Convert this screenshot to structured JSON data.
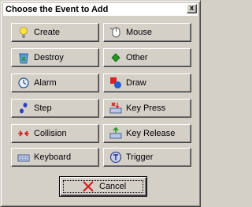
{
  "window": {
    "title": "Choose the Event to Add",
    "close_glyph": "x"
  },
  "events": [
    {
      "label": "Create",
      "icon": "lightbulb-icon"
    },
    {
      "label": "Mouse",
      "icon": "mouse-icon"
    },
    {
      "label": "Destroy",
      "icon": "trash-icon"
    },
    {
      "label": "Other",
      "icon": "green-diamond-icon"
    },
    {
      "label": "Alarm",
      "icon": "clock-icon"
    },
    {
      "label": "Draw",
      "icon": "shapes-icon"
    },
    {
      "label": "Step",
      "icon": "footsteps-icon"
    },
    {
      "label": "Key Press",
      "icon": "key-press-icon"
    },
    {
      "label": "Collision",
      "icon": "collision-arrows-icon"
    },
    {
      "label": "Key Release",
      "icon": "key-release-icon"
    },
    {
      "label": "Keyboard",
      "icon": "keyboard-icon"
    },
    {
      "label": "Trigger",
      "icon": "trigger-icon"
    }
  ],
  "cancel": {
    "label": "Cancel",
    "icon": "red-x-icon"
  }
}
